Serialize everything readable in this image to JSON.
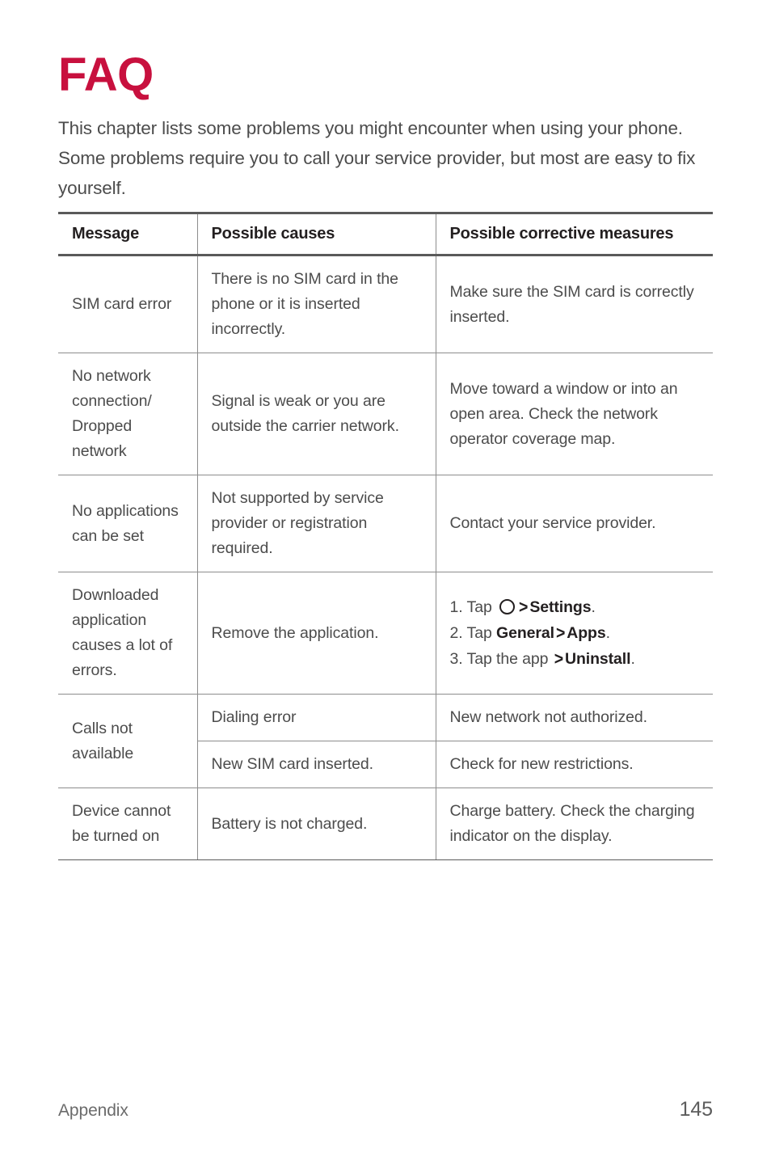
{
  "page": {
    "title": "FAQ",
    "intro": "This chapter lists some problems you might encounter when using your phone. Some problems require you to call your service provider, but most are easy to fix yourself.",
    "accent_color": "#c8103e",
    "text_color": "#4c4c4c"
  },
  "table": {
    "headers": {
      "message": "Message",
      "causes": "Possible causes",
      "measures": "Possible corrective measures"
    },
    "rows": [
      {
        "message": "SIM card error",
        "cause": "There is no SIM card in the phone or it is inserted incorrectly.",
        "measure": "Make sure the SIM card is correctly inserted."
      },
      {
        "message": "No network connection/ Dropped network",
        "cause": "Signal is weak or you are outside the carrier network.",
        "measure": "Move toward a window or into an open area. Check the network operator coverage map."
      },
      {
        "message": "No applications can be set",
        "cause": "Not supported by service provider or registration required.",
        "measure": "Contact your service provider."
      },
      {
        "message": "Downloaded application causes a lot of errors.",
        "cause": "Remove the application.",
        "steps": [
          {
            "number": "1.",
            "prefix": "Tap",
            "icon": "home-circle-icon",
            "chevron": ">",
            "bold": "Settings",
            "suffix": "."
          },
          {
            "number": "2.",
            "prefix": "Tap",
            "bold_pre": "General",
            "chevron": ">",
            "bold": "Apps",
            "suffix": "."
          },
          {
            "number": "3.",
            "prefix": "Tap the app",
            "chevron": ">",
            "bold": "Uninstall",
            "suffix": "."
          }
        ]
      },
      {
        "message": "Calls not available",
        "subrows": [
          {
            "cause": "Dialing error",
            "measure": "New network not authorized."
          },
          {
            "cause": "New SIM card inserted.",
            "measure": "Check for new restrictions."
          }
        ]
      },
      {
        "message": "Device cannot be turned on",
        "cause": "Battery is not charged.",
        "measure": "Charge battery. Check the charging indicator on the display."
      }
    ]
  },
  "footer": {
    "section": "Appendix",
    "page_number": "145"
  }
}
